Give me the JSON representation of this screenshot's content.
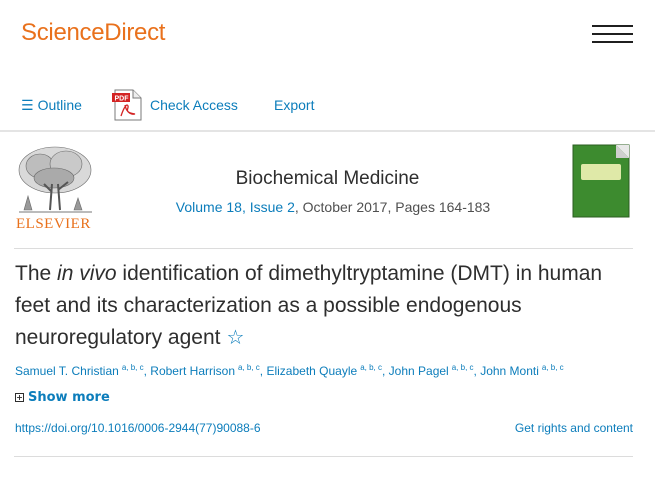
{
  "header": {
    "logo_text": "ScienceDirect",
    "menu_icon": "hamburger-menu-icon"
  },
  "toolbar": {
    "outline_label": "Outline",
    "check_access_label": "Check Access",
    "export_label": "Export",
    "pdf_badge": "PDF"
  },
  "publication": {
    "publisher_logo_text": "ELSEVIER",
    "journal_title": "Biochemical Medicine",
    "volume_issue": "Volume 18, Issue 2",
    "date_pages": ", October 2017, Pages 164-183"
  },
  "article": {
    "title_part1": "The ",
    "title_italic": "in vivo",
    "title_part2": " identification of dimethyltryptamine (DMT) in human feet and its characterization as a possible endogenous neuroregulatory agent",
    "star_icon": "☆",
    "authors": [
      {
        "name": "Samuel T. Christian",
        "affil": "a, b, c"
      },
      {
        "name": "Robert Harrison",
        "affil": "a, b, c"
      },
      {
        "name": "Elizabeth Quayle",
        "affil": "a, b, c"
      },
      {
        "name": "John Pagel",
        "affil": "a, b, c"
      },
      {
        "name": "John Monti",
        "affil": "a, b, c"
      }
    ],
    "show_more_label": "Show more",
    "doi": "https://doi.org/10.1016/0006-2944(77)90088-6",
    "rights_label": "Get rights and content"
  },
  "colors": {
    "brand_orange": "#e9711c",
    "link_blue": "#0c7dbb",
    "cover_green": "#3d8b2f"
  }
}
